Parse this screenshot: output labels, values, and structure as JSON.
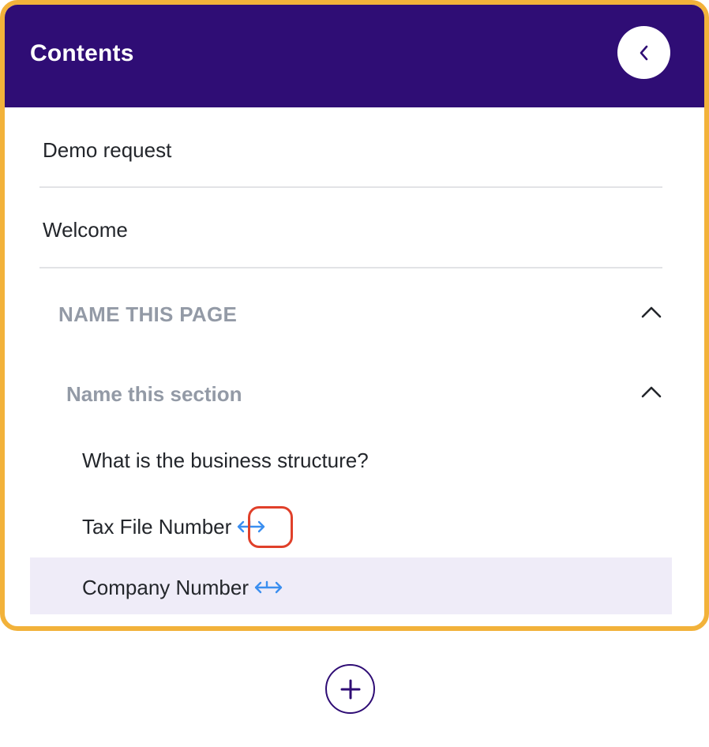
{
  "header": {
    "title": "Contents",
    "collapse_icon": "chevron-left-icon"
  },
  "items": [
    {
      "label": "Demo request"
    },
    {
      "label": "Welcome"
    }
  ],
  "page_group": {
    "title": "NAME THIS PAGE",
    "expanded": true,
    "section": {
      "title": "Name this section",
      "expanded": true,
      "questions": [
        {
          "label": "What is the business structure?",
          "icon": ""
        },
        {
          "label": "Tax File Number",
          "icon": "link-arrows-icon",
          "highlighted_icon": true
        },
        {
          "label": "Company Number",
          "icon": "link-arrows-icon",
          "selected": true
        }
      ]
    }
  },
  "add_button": {
    "icon": "plus-icon"
  },
  "colors": {
    "header_bg": "#2f0d75",
    "frame_border": "#f2b23a",
    "selected_row_bg": "#efecf8",
    "link_icon": "#3b8ff0",
    "highlight_ring": "#e0402a",
    "muted_text": "#939aa6"
  }
}
